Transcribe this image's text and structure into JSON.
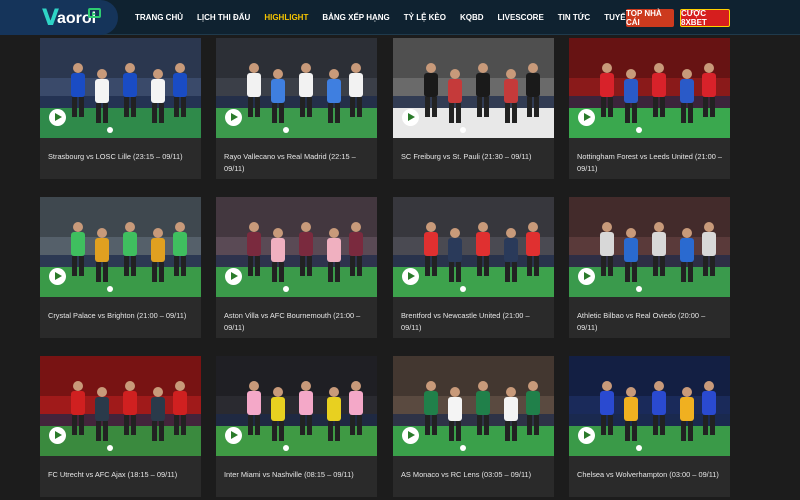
{
  "header": {
    "logo_text": "aoroi",
    "nav": [
      "TRANG CHỦ",
      "LỊCH THI ĐẤU",
      "HIGHLIGHT",
      "BẢNG XẾP HẠNG",
      "TỶ LỆ KÈO",
      "KQBD",
      "LIVESCORE",
      "TIN TỨC",
      "TUYỂN DỤNG"
    ],
    "active_nav": "HIGHLIGHT",
    "btn_top": "TOP NHÀ CÁI",
    "btn_cuoc": "CƯỢC 8XBET"
  },
  "matches": [
    {
      "title": "Strasbourg vs LOSC Lille (23:15 – 09/11)",
      "theme": {
        "sky": "#3a4a6a",
        "pitch": "#2f8a4a",
        "shirt_a": "#1a4cc4",
        "shirt_b": "#f4f4f4"
      }
    },
    {
      "title": "Rayo Vallecano vs Real Madrid (22:15 – 09/11)",
      "theme": {
        "sky": "#3b3f48",
        "pitch": "#3c9a4c",
        "shirt_a": "#f2f2f2",
        "shirt_b": "#3f7fe0"
      }
    },
    {
      "title": "SC Freiburg vs St. Pauli (21:30 – 09/11)",
      "theme": {
        "sky": "#6a6a6a",
        "pitch": "#e8e8e8",
        "shirt_a": "#1a1a1a",
        "shirt_b": "#c53a3a"
      }
    },
    {
      "title": "Nottingham Forest vs Leeds United (21:00 – 09/11)",
      "theme": {
        "sky": "#8a1a1a",
        "pitch": "#3aa84e",
        "shirt_a": "#d8222a",
        "shirt_b": "#2a5ac8"
      }
    },
    {
      "title": "Crystal Palace vs Brighton (21:00 – 09/11)",
      "theme": {
        "sky": "#55606a",
        "pitch": "#3a9a48",
        "shirt_a": "#3fbf5f",
        "shirt_b": "#e0a020"
      }
    },
    {
      "title": "Aston Villa vs AFC Bournemouth (21:00 – 09/11)",
      "theme": {
        "sky": "#5a4a55",
        "pitch": "#3b9a4a",
        "shirt_a": "#7a2a3e",
        "shirt_b": "#f0b0c0"
      }
    },
    {
      "title": "Brentford vs Newcastle United (21:00 – 09/11)",
      "theme": {
        "sky": "#4a4a52",
        "pitch": "#3da24c",
        "shirt_a": "#e03030",
        "shirt_b": "#2a3a5a"
      }
    },
    {
      "title": "Athletic Bilbao vs Real Oviedo (20:00 – 09/11)",
      "theme": {
        "sky": "#5a3a3a",
        "pitch": "#3a9a4c",
        "shirt_a": "#d8d8d8",
        "shirt_b": "#2a6ad0"
      }
    },
    {
      "title": "FC Utrecht vs AFC Ajax (18:15 – 09/11)",
      "theme": {
        "sky": "#a01a1a",
        "pitch": "#3a8a3e",
        "shirt_a": "#d02020",
        "shirt_b": "#2a3a4a"
      }
    },
    {
      "title": "Inter Miami vs Nashville (08:15 – 09/11)",
      "theme": {
        "sky": "#2a2a30",
        "pitch": "#3f9a44",
        "shirt_a": "#f4a8c8",
        "shirt_b": "#e8d020"
      }
    },
    {
      "title": "AS Monaco vs RC Lens (03:05 – 09/11)",
      "theme": {
        "sky": "#5a4a40",
        "pitch": "#3aa04a",
        "shirt_a": "#20804a",
        "shirt_b": "#f4f4f4"
      }
    },
    {
      "title": "Chelsea vs Wolverhampton (03:00 – 09/11)",
      "theme": {
        "sky": "#1a2a5a",
        "pitch": "#3a9a48",
        "shirt_a": "#2a4ad0",
        "shirt_b": "#f0b020"
      }
    }
  ]
}
